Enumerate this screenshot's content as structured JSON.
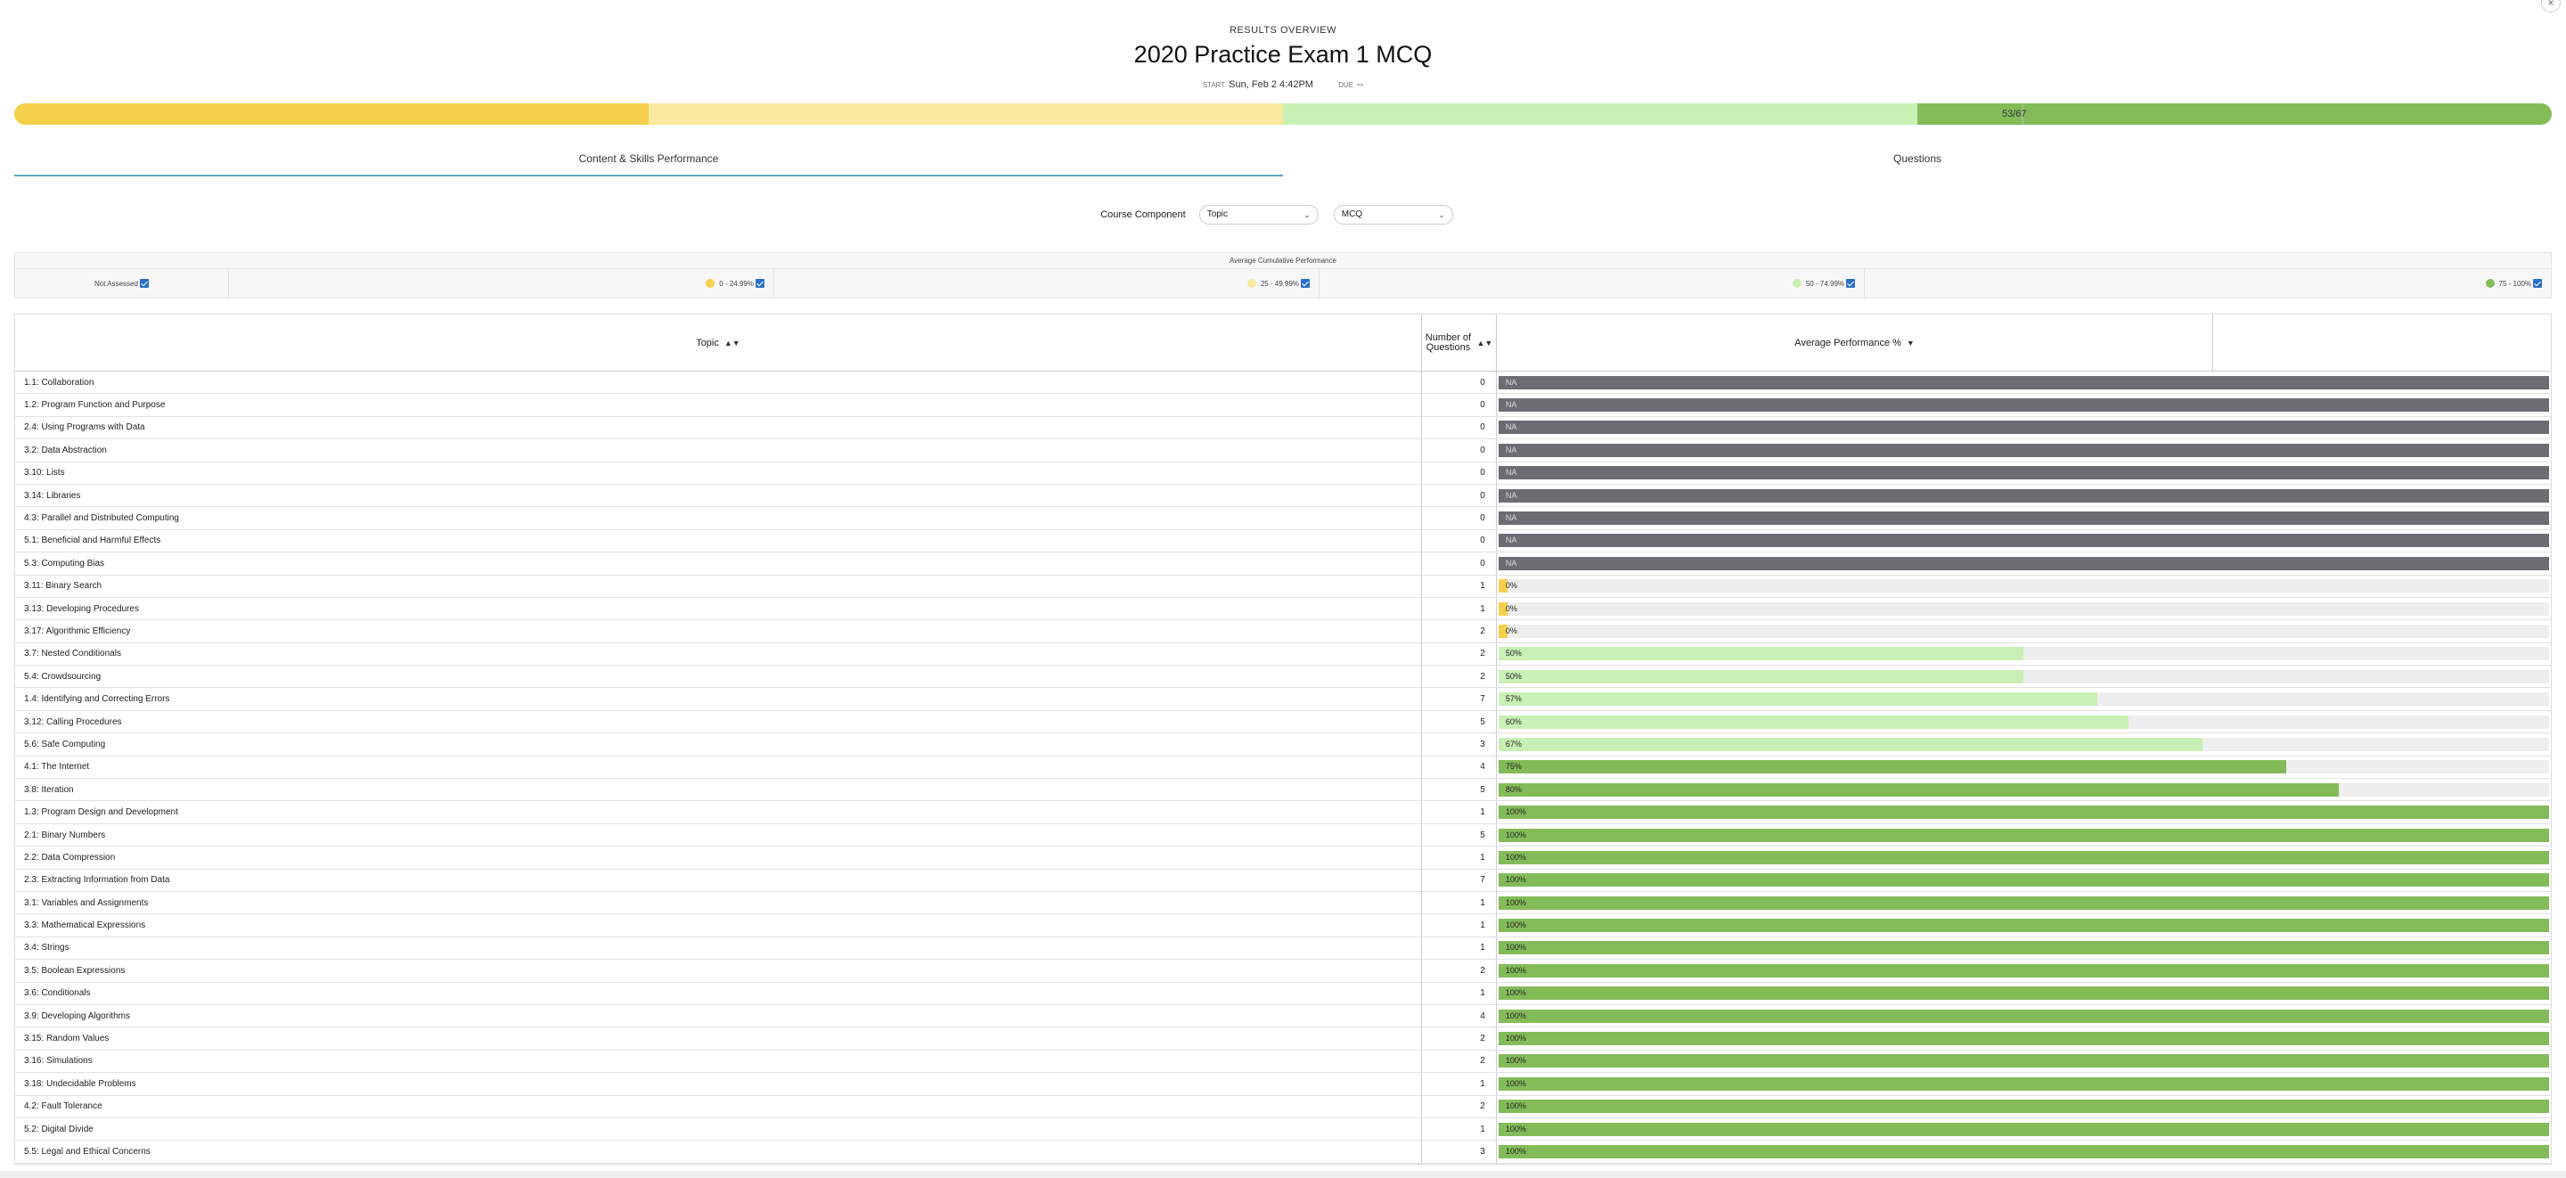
{
  "header": {
    "eyebrow": "RESULTS OVERVIEW",
    "title": "2020 Practice Exam 1 MCQ",
    "start_label": "START",
    "start_value": "Sun, Feb 2 4:42PM",
    "due_label": "DUE",
    "due_value": "--"
  },
  "progress": {
    "score_text": "53/67",
    "score_fraction": 0.791
  },
  "tabs": [
    "Content & Skills Performance",
    "Questions"
  ],
  "filters": {
    "label": "Course Component",
    "select1": "Topic",
    "select2": "MCQ"
  },
  "legend": {
    "title": "Average Cumulative Performance",
    "items": [
      "Not Assessed",
      "0 - 24.99%",
      "25 - 49.99%",
      "50 - 74.99%",
      "75 - 100%"
    ]
  },
  "colors": {
    "na": "#6c6c72",
    "low": "#f5d04c",
    "mid_low": "#faea9f",
    "mid_high": "#c9f0b4",
    "high": "#84bb59"
  },
  "table": {
    "headers": {
      "topic": "Topic",
      "num": "Number of Questions",
      "perf": "Average Performance %"
    },
    "rows": [
      {
        "topic": "1.1:  Collaboration",
        "n": "0",
        "label": "NA",
        "pct": null
      },
      {
        "topic": "1.2:  Program Function and Purpose",
        "n": "0",
        "label": "NA",
        "pct": null
      },
      {
        "topic": "2.4:  Using Programs with Data",
        "n": "0",
        "label": "NA",
        "pct": null
      },
      {
        "topic": "3.2:  Data Abstraction",
        "n": "0",
        "label": "NA",
        "pct": null
      },
      {
        "topic": "3.10:  Lists",
        "n": "0",
        "label": "NA",
        "pct": null
      },
      {
        "topic": "3.14:  Libraries",
        "n": "0",
        "label": "NA",
        "pct": null
      },
      {
        "topic": "4.3:  Parallel and Distributed Computing",
        "n": "0",
        "label": "NA",
        "pct": null
      },
      {
        "topic": "5.1:  Beneficial and Harmful Effects",
        "n": "0",
        "label": "NA",
        "pct": null
      },
      {
        "topic": "5.3:  Computing Bias",
        "n": "0",
        "label": "NA",
        "pct": null
      },
      {
        "topic": "3.11:  Binary Search",
        "n": "1",
        "label": "0%",
        "pct": 0
      },
      {
        "topic": "3.13:  Developing Procedures",
        "n": "1",
        "label": "0%",
        "pct": 0
      },
      {
        "topic": "3.17:  Algorithmic Efficiency",
        "n": "2",
        "label": "0%",
        "pct": 0
      },
      {
        "topic": "3.7:  Nested Conditionals",
        "n": "2",
        "label": "50%",
        "pct": 50
      },
      {
        "topic": "5.4:  Crowdsourcing",
        "n": "2",
        "label": "50%",
        "pct": 50
      },
      {
        "topic": "1.4:  Identifying and Correcting Errors",
        "n": "7",
        "label": "57%",
        "pct": 57
      },
      {
        "topic": "3.12:  Calling Procedures",
        "n": "5",
        "label": "60%",
        "pct": 60
      },
      {
        "topic": "5.6:  Safe Computing",
        "n": "3",
        "label": "67%",
        "pct": 67
      },
      {
        "topic": "4.1:  The Internet",
        "n": "4",
        "label": "75%",
        "pct": 75
      },
      {
        "topic": "3.8:  Iteration",
        "n": "5",
        "label": "80%",
        "pct": 80
      },
      {
        "topic": "1.3:  Program Design and Development",
        "n": "1",
        "label": "100%",
        "pct": 100
      },
      {
        "topic": "2.1:  Binary Numbers",
        "n": "5",
        "label": "100%",
        "pct": 100
      },
      {
        "topic": "2.2:  Data Compression",
        "n": "1",
        "label": "100%",
        "pct": 100
      },
      {
        "topic": "2.3:  Extracting Information from Data",
        "n": "7",
        "label": "100%",
        "pct": 100
      },
      {
        "topic": "3.1:  Variables and Assignments",
        "n": "1",
        "label": "100%",
        "pct": 100
      },
      {
        "topic": "3.3:  Mathematical Expressions",
        "n": "1",
        "label": "100%",
        "pct": 100
      },
      {
        "topic": "3.4:  Strings",
        "n": "1",
        "label": "100%",
        "pct": 100
      },
      {
        "topic": "3.5:  Boolean Expressions",
        "n": "2",
        "label": "100%",
        "pct": 100
      },
      {
        "topic": "3.6:  Conditionals",
        "n": "1",
        "label": "100%",
        "pct": 100
      },
      {
        "topic": "3.9:  Developing Algorithms",
        "n": "4",
        "label": "100%",
        "pct": 100
      },
      {
        "topic": "3.15:  Random Values",
        "n": "2",
        "label": "100%",
        "pct": 100
      },
      {
        "topic": "3.16:  Simulations",
        "n": "2",
        "label": "100%",
        "pct": 100
      },
      {
        "topic": "3.18:  Undecidable Problems",
        "n": "1",
        "label": "100%",
        "pct": 100
      },
      {
        "topic": "4.2:  Fault Tolerance",
        "n": "2",
        "label": "100%",
        "pct": 100
      },
      {
        "topic": "5.2:  Digital Divide",
        "n": "1",
        "label": "100%",
        "pct": 100
      },
      {
        "topic": "5.5:  Legal and Ethical Concerns",
        "n": "3",
        "label": "100%",
        "pct": 100
      }
    ]
  }
}
